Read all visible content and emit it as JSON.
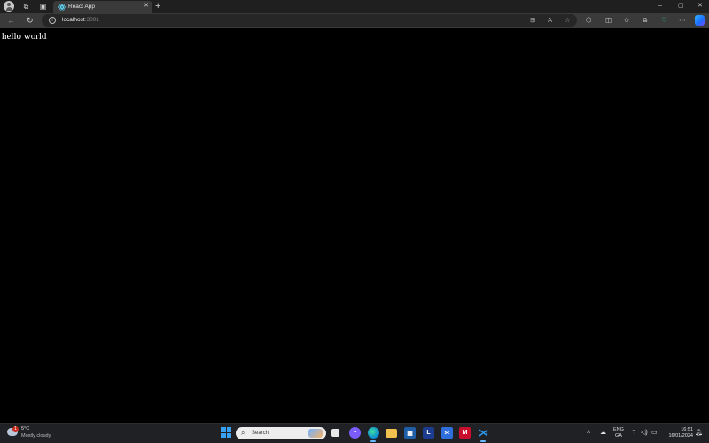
{
  "browser": {
    "tab": {
      "title": "React App"
    },
    "address_bar": {
      "host": "localhost",
      "port": ":3001"
    },
    "window_controls": {
      "minimize": "–",
      "maximize": "▢",
      "close": "✕"
    }
  },
  "page": {
    "text": "hello world"
  },
  "taskbar": {
    "weather": {
      "badge": "1",
      "temperature": "5°C",
      "condition": "Mostly cloudy"
    },
    "search": {
      "label": "Search"
    },
    "pinned_apps": [
      {
        "name": "file-explorer",
        "glyph": ""
      },
      {
        "name": "edge",
        "glyph": ""
      },
      {
        "name": "l-app",
        "glyph": "L"
      },
      {
        "name": "mcafee",
        "glyph": "M"
      },
      {
        "name": "vscode",
        "glyph": ""
      }
    ],
    "language": {
      "line1": "ENG",
      "line2": "GA"
    },
    "clock": {
      "time": "16:51",
      "date": "16/01/2024"
    }
  },
  "colors": {
    "accent": "#3aa0f2",
    "page_background": "#000000",
    "tab_background": "#3a3a3a",
    "taskbar_background": "#202124"
  }
}
